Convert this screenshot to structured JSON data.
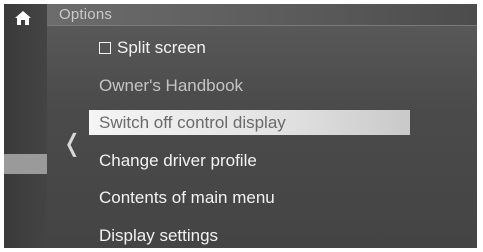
{
  "header": {
    "title": "Options",
    "home_icon": "home-icon"
  },
  "navigation": {
    "back_icon": "chevron-left-icon",
    "back_glyph": "❬"
  },
  "menu": {
    "items": [
      {
        "label": "Split screen",
        "type": "checkbox",
        "checked": false
      },
      {
        "label": "Owner's Handbook",
        "state": "dimmed"
      },
      {
        "label": "Switch off control display",
        "state": "selected"
      },
      {
        "label": "Change driver profile"
      },
      {
        "label": "Contents of main menu"
      },
      {
        "label": "Display settings"
      }
    ]
  },
  "colors": {
    "background": "#4b4b4b",
    "text": "#f2f2f2",
    "highlight": "#e8e8e8"
  }
}
